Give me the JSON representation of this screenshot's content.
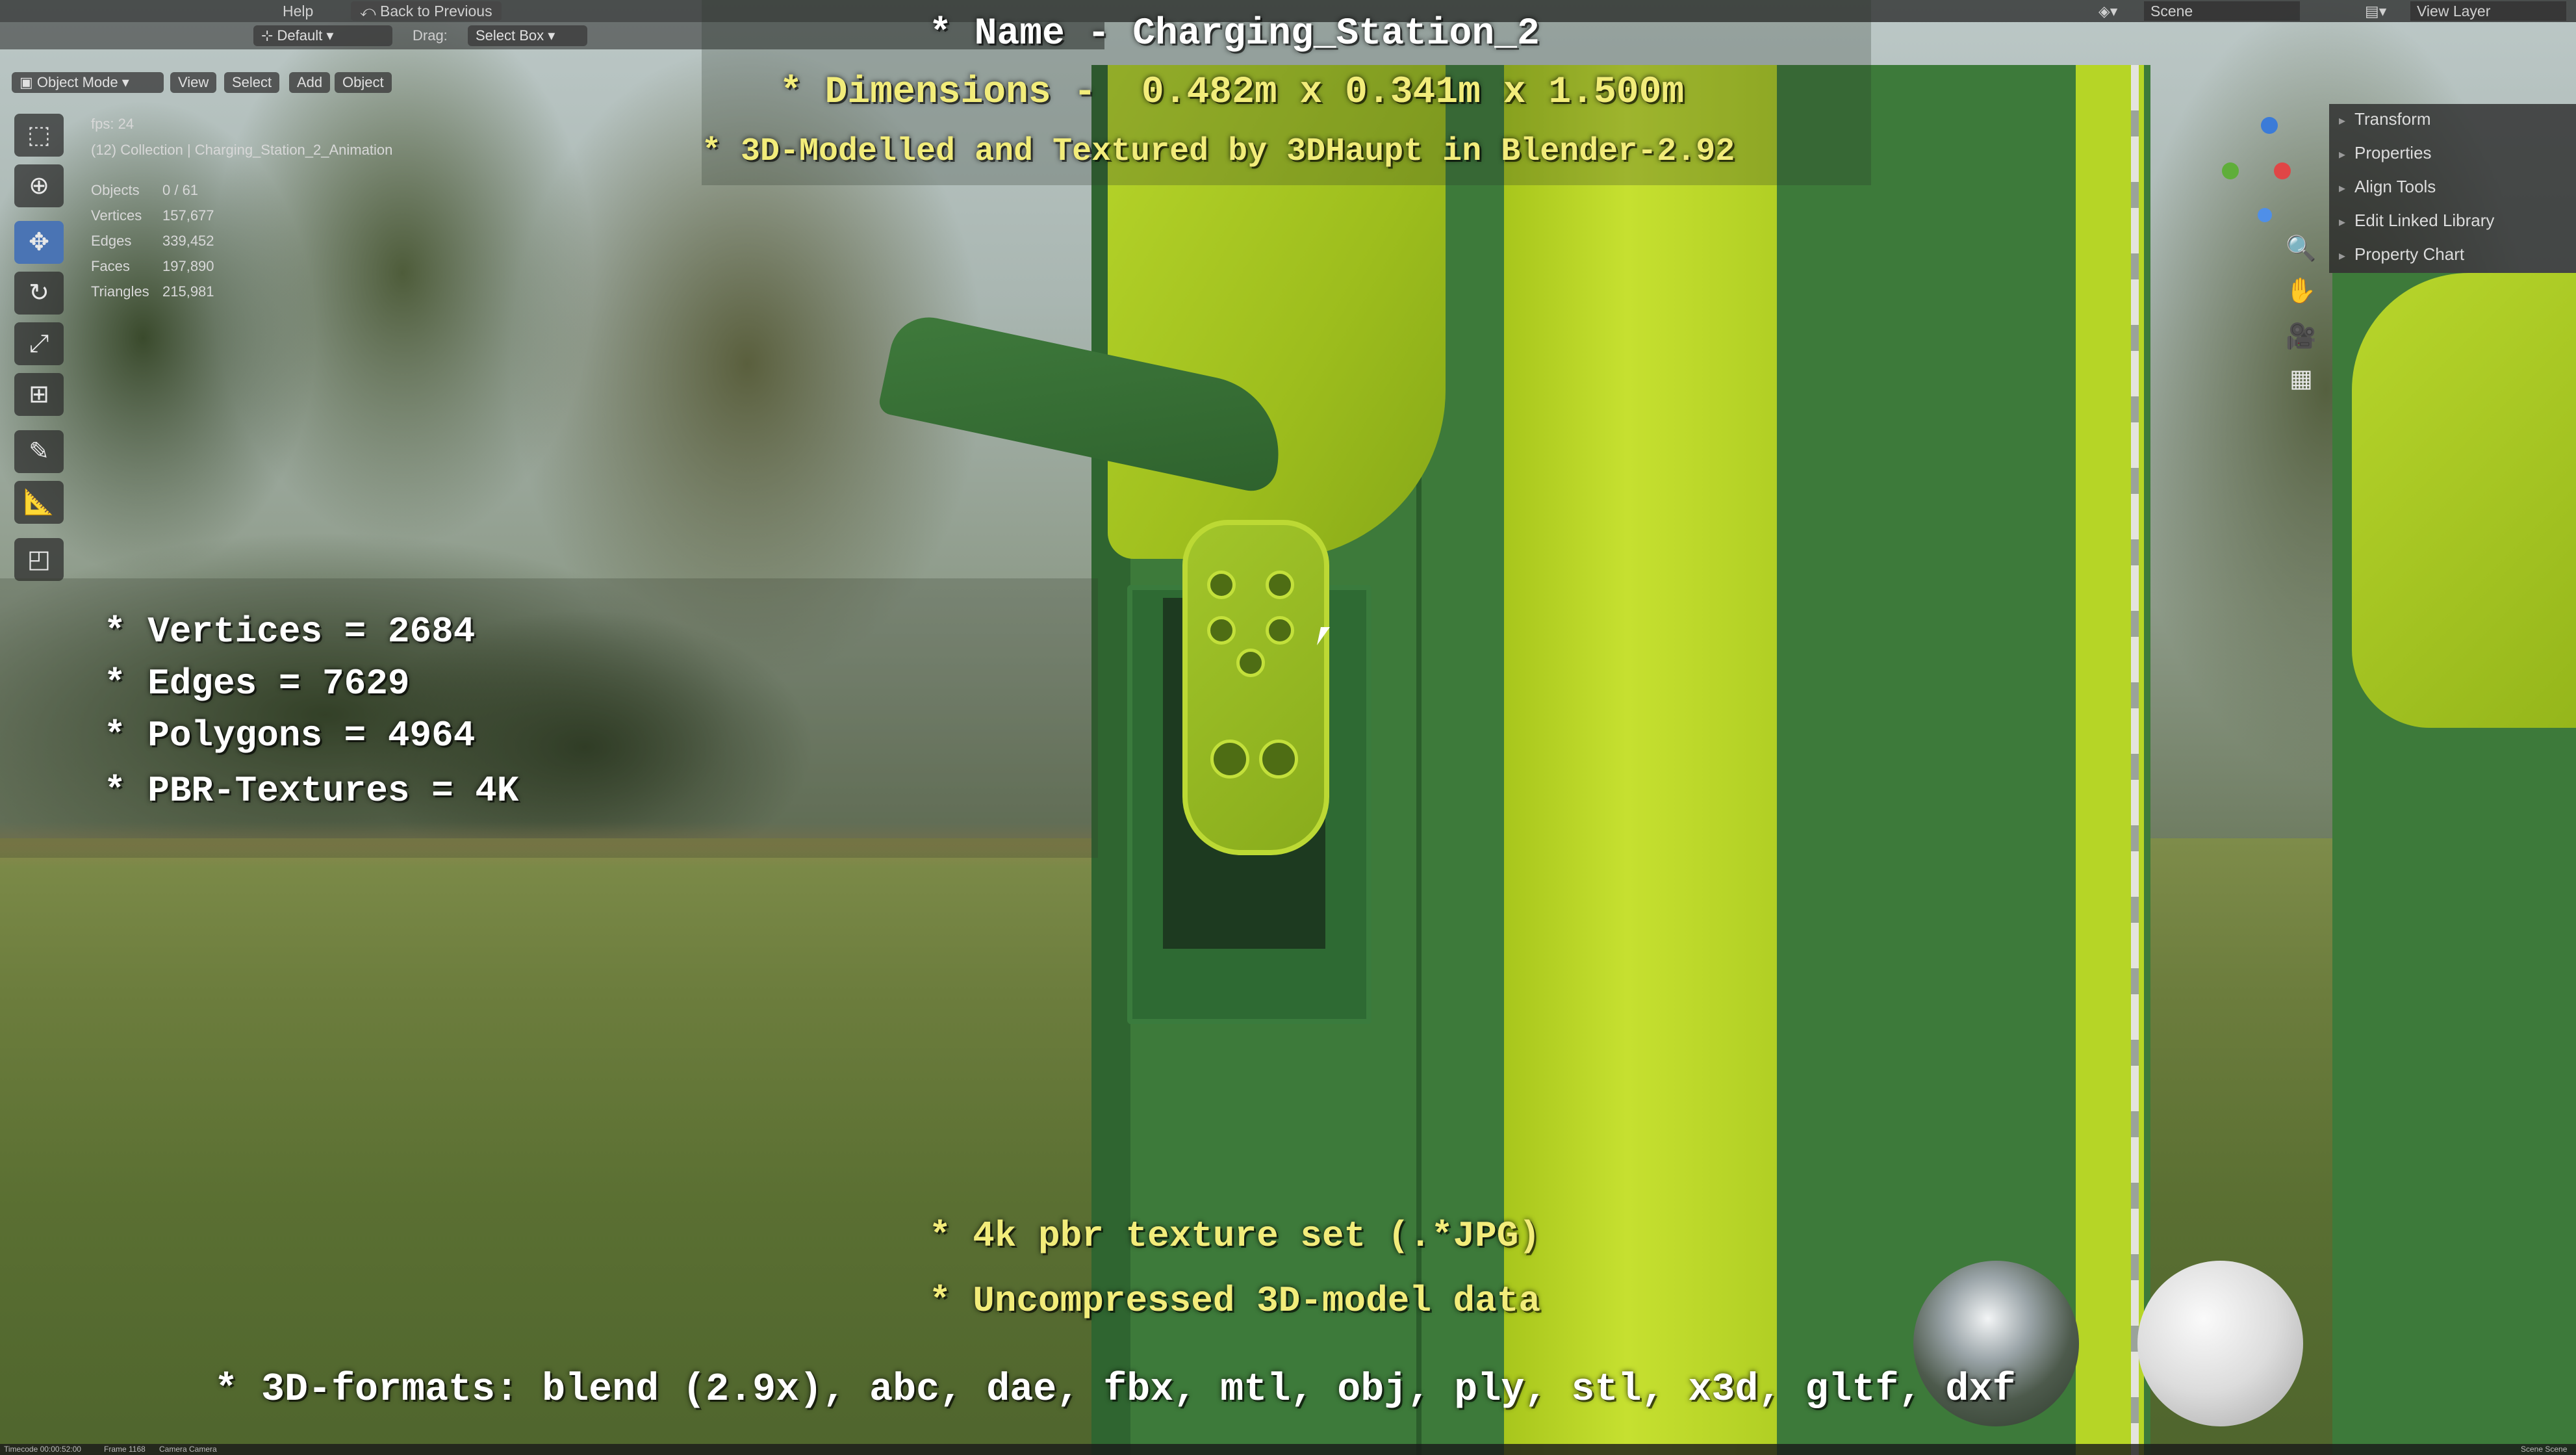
{
  "topbar": {
    "menu": [
      "Help"
    ],
    "back_button": "Back to Previous",
    "scene_label": "Scene",
    "view_layer_label": "View Layer"
  },
  "header": {
    "orientation_value": "Default",
    "drag_label": "Drag:",
    "drag_value": "Select Box"
  },
  "viewport_header": {
    "mode": "Object Mode",
    "menus": [
      "View",
      "Select",
      "Add",
      "Object"
    ]
  },
  "overlay_info": {
    "fps": "fps: 24",
    "collection": "(12) Collection | Charging_Station_2_Animation",
    "stats": [
      {
        "label": "Objects",
        "value": "0 / 61"
      },
      {
        "label": "Vertices",
        "value": "157,677"
      },
      {
        "label": "Edges",
        "value": "339,452"
      },
      {
        "label": "Faces",
        "value": "197,890"
      },
      {
        "label": "Triangles",
        "value": "215,981"
      }
    ]
  },
  "right_panel": {
    "items": [
      "Transform",
      "Properties",
      "Align Tools",
      "Edit Linked Library",
      "Property Chart"
    ]
  },
  "captions": {
    "name": "* Name - Charging_Station_2",
    "dimensions": "* Dimensions -  0.482m x 0.341m x 1.500m",
    "credit": "* 3D-Modelled and Textured by 3DHaupt in Blender-2.92",
    "vertices": "* Vertices = 2684",
    "edges": "* Edges = 7629",
    "polygons": "* Polygons = 4964",
    "textures": "* PBR-Textures = 4K",
    "texture_set": "* 4k pbr texture set (.*JPG)",
    "uncompressed": "* Uncompressed 3D-model data",
    "formats": "* 3D-formats: blend (2.9x), abc, dae, fbx, mtl, obj, ply, stl, x3d, gltf, dxf"
  },
  "status_bar": {
    "timecode": "Timecode 00:00:52:00",
    "frame": "Frame 1168",
    "camera": "Camera Camera",
    "scene": "Scene Scene"
  },
  "icons": [
    "select-box-icon",
    "cursor-icon",
    "move-icon",
    "rotate-icon",
    "scale-icon",
    "transform-icon",
    "annotate-icon",
    "measure-icon",
    "add-cube-icon",
    "zoom-icon",
    "hand-icon",
    "camera-icon",
    "grid-icon"
  ]
}
